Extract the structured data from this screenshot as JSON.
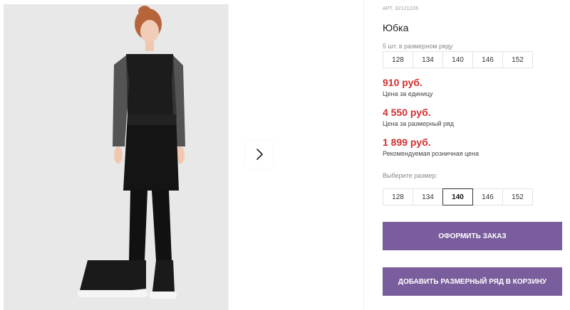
{
  "product": {
    "article": "АРТ. 32121226",
    "title": "Юбка",
    "pack_note": "5 шт. в размерном ряду",
    "pack_sizes": [
      "128",
      "134",
      "140",
      "146",
      "152"
    ]
  },
  "prices": [
    {
      "value": "910 руб.",
      "label": "Цена за единицу"
    },
    {
      "value": "4 550 руб.",
      "label": "Цена за размерный ряд"
    },
    {
      "value": "1 899 руб.",
      "label": "Рекомендуемая розничная цена"
    }
  ],
  "size_picker": {
    "label": "Выберите размер:",
    "sizes": [
      "128",
      "134",
      "140",
      "146",
      "152"
    ],
    "selected": "140"
  },
  "buttons": {
    "order": "ОФОРМИТЬ ЗАКАЗ",
    "add_pack": "ДОБАВИТЬ РАЗМЕРНЫЙ РЯД В КОРЗИНУ"
  },
  "colors": {
    "accent": "#7a5d9d",
    "price": "#d32f2f"
  },
  "icons": {
    "next": "chevron-right-icon"
  }
}
